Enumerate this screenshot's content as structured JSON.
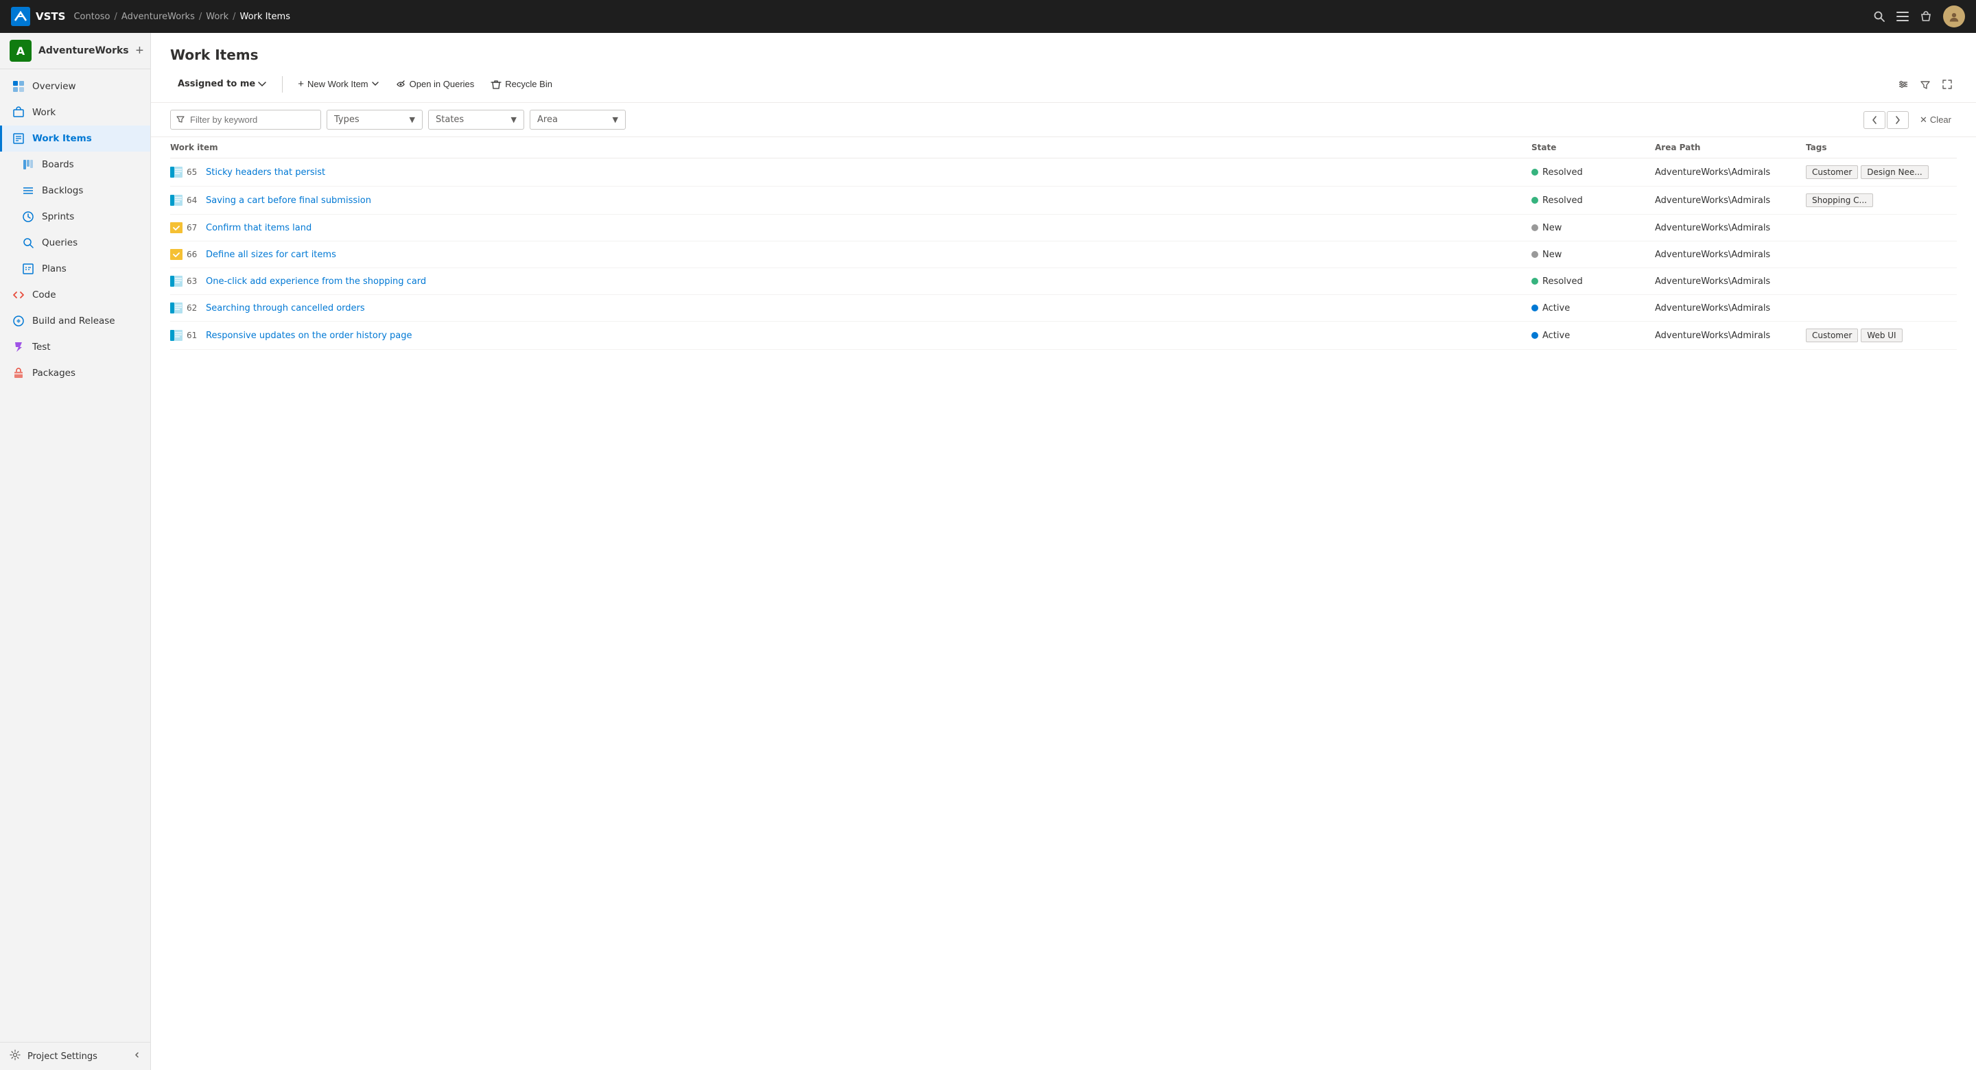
{
  "topNav": {
    "brand": "VSTS",
    "breadcrumb": [
      "Contoso",
      "AdventureWorks",
      "Work",
      "Work Items"
    ],
    "breadcrumbSeps": [
      "/",
      "/",
      "/"
    ]
  },
  "sidebar": {
    "projectInitial": "A",
    "projectName": "AdventureWorks",
    "addLabel": "+",
    "items": [
      {
        "id": "overview",
        "label": "Overview",
        "icon": "overview",
        "active": false
      },
      {
        "id": "work",
        "label": "Work",
        "icon": "work",
        "active": false
      },
      {
        "id": "workitems",
        "label": "Work Items",
        "icon": "workitems",
        "active": true
      },
      {
        "id": "boards",
        "label": "Boards",
        "icon": "boards",
        "active": false
      },
      {
        "id": "backlogs",
        "label": "Backlogs",
        "icon": "backlogs",
        "active": false
      },
      {
        "id": "sprints",
        "label": "Sprints",
        "icon": "sprints",
        "active": false
      },
      {
        "id": "queries",
        "label": "Queries",
        "icon": "queries",
        "active": false
      },
      {
        "id": "plans",
        "label": "Plans",
        "icon": "plans",
        "active": false
      },
      {
        "id": "code",
        "label": "Code",
        "icon": "code",
        "active": false
      },
      {
        "id": "build",
        "label": "Build and Release",
        "icon": "build",
        "active": false
      },
      {
        "id": "test",
        "label": "Test",
        "icon": "test",
        "active": false
      },
      {
        "id": "packages",
        "label": "Packages",
        "icon": "packages",
        "active": false
      }
    ],
    "footer": {
      "label": "Project Settings"
    }
  },
  "page": {
    "title": "Work Items"
  },
  "toolbar": {
    "assignedLabel": "Assigned to me",
    "newWorkItemLabel": "New Work Item",
    "openQueriesLabel": "Open in Queries",
    "recycleBinLabel": "Recycle Bin"
  },
  "filters": {
    "placeholder": "Filter by keyword",
    "types": "Types",
    "states": "States",
    "area": "Area",
    "clearLabel": "Clear"
  },
  "table": {
    "columns": [
      "Work item",
      "State",
      "Area Path",
      "Tags"
    ],
    "rows": [
      {
        "id": "65",
        "iconType": "story",
        "title": "Sticky headers that persist",
        "state": "Resolved",
        "stateDot": "resolved",
        "areaPath": "AdventureWorks\\Admirals",
        "tags": [
          "Customer",
          "Design Nee..."
        ]
      },
      {
        "id": "64",
        "iconType": "story",
        "title": "Saving a cart before final submission",
        "state": "Resolved",
        "stateDot": "resolved",
        "areaPath": "AdventureWorks\\Admirals",
        "tags": [
          "Shopping C..."
        ]
      },
      {
        "id": "67",
        "iconType": "task",
        "title": "Confirm that items land",
        "state": "New",
        "stateDot": "new",
        "areaPath": "AdventureWorks\\Admirals",
        "tags": []
      },
      {
        "id": "66",
        "iconType": "task",
        "title": "Define all sizes for cart items",
        "state": "New",
        "stateDot": "new",
        "areaPath": "AdventureWorks\\Admirals",
        "tags": []
      },
      {
        "id": "63",
        "iconType": "story",
        "title": "One-click add experience from the shopping card",
        "state": "Resolved",
        "stateDot": "resolved",
        "areaPath": "AdventureWorks\\Admirals",
        "tags": []
      },
      {
        "id": "62",
        "iconType": "story",
        "title": "Searching through cancelled orders",
        "state": "Active",
        "stateDot": "active",
        "areaPath": "AdventureWorks\\Admirals",
        "tags": []
      },
      {
        "id": "61",
        "iconType": "story",
        "title": "Responsive updates on the order history page",
        "state": "Active",
        "stateDot": "active",
        "areaPath": "AdventureWorks\\Admirals",
        "tags": [
          "Customer",
          "Web UI"
        ]
      }
    ]
  }
}
